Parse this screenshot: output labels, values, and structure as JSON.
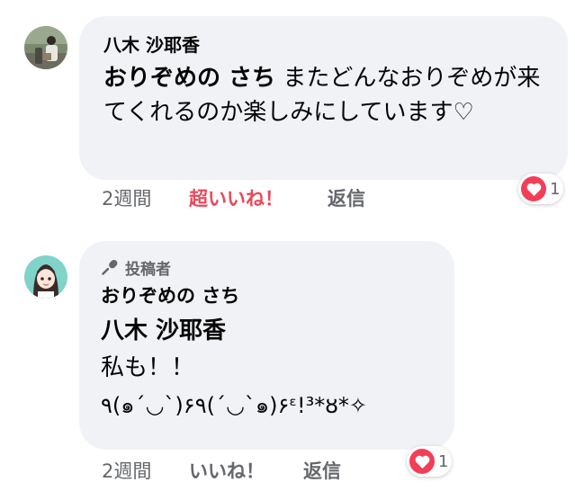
{
  "comments": [
    {
      "author": "八木 沙耶香",
      "mention": "おりぞめの さち",
      "text": " またどんなおりぞめが来てくれるのか楽しみにしています♡",
      "time": "2週間",
      "like_label": "超いいね！",
      "reply_label": "返信",
      "reaction_count": "1",
      "reaction_color": "#f33e58",
      "like_color": "#e8495b"
    },
    {
      "badge": "投稿者",
      "author": "おりぞめの さち",
      "mention": "八木 沙耶香",
      "text_line1": "私も！！",
      "text_line2": "٩(๑´◡`)۶٩(´◡`๑)۶ᵋ!³*ȣ*✧",
      "time": "2週間",
      "like_label": "いいね！",
      "reply_label": "返信",
      "reaction_count": "1",
      "reaction_color": "#f33e58"
    }
  ],
  "icons": {
    "badge_icon": "microphone-icon",
    "reaction_icon": "heart-icon"
  }
}
